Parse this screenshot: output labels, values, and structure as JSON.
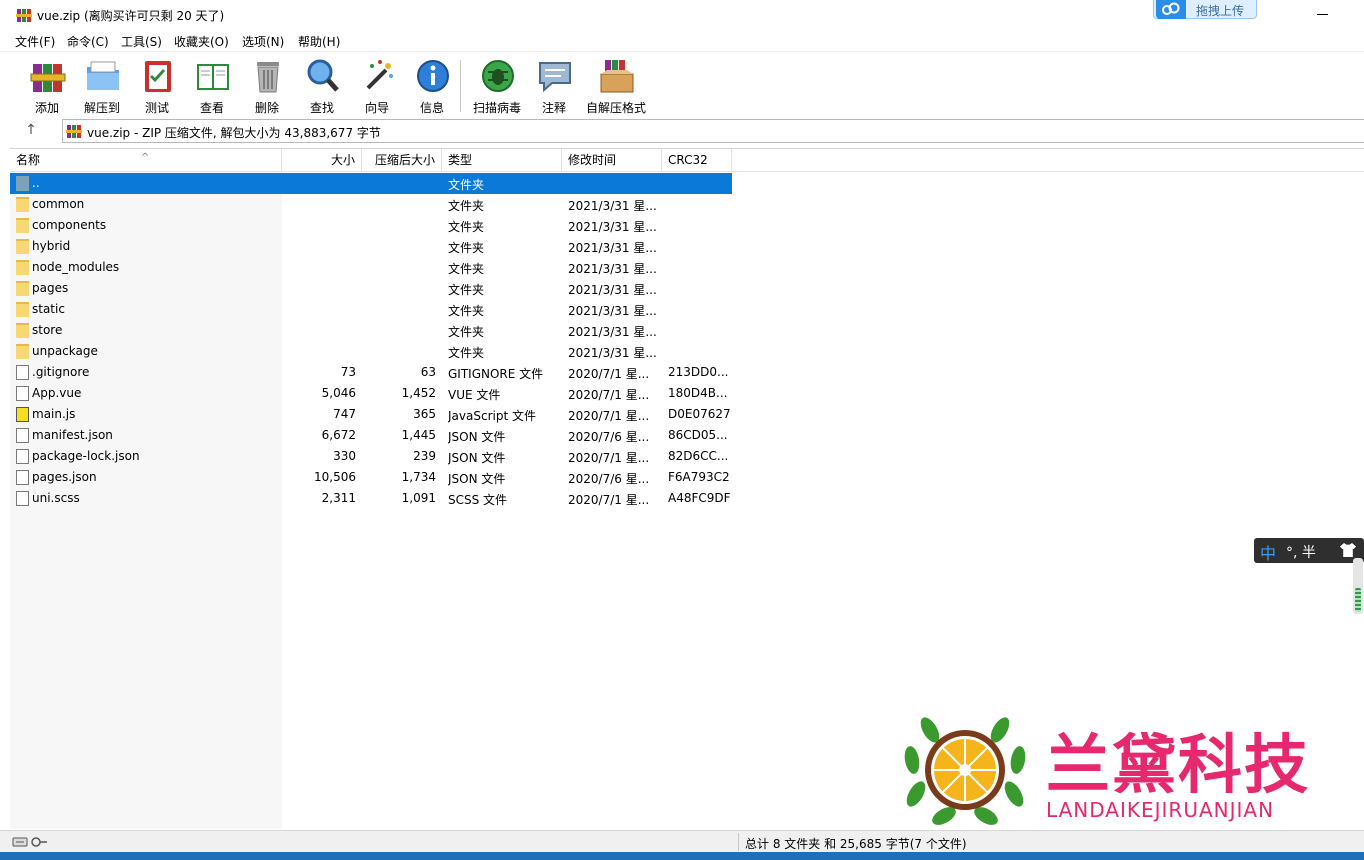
{
  "window": {
    "title": "vue.zip (离购买许可只剩 20 天了)",
    "upload_button": "拖拽上传"
  },
  "menu": [
    "文件(F)",
    "命令(C)",
    "工具(S)",
    "收藏夹(O)",
    "选项(N)",
    "帮助(H)"
  ],
  "toolbar": [
    {
      "label": "添加",
      "icon": "books-add-icon"
    },
    {
      "label": "解压到",
      "icon": "folder-extract-icon"
    },
    {
      "label": "测试",
      "icon": "clipboard-test-icon"
    },
    {
      "label": "查看",
      "icon": "book-view-icon"
    },
    {
      "label": "删除",
      "icon": "trash-icon"
    },
    {
      "label": "查找",
      "icon": "magnifier-icon"
    },
    {
      "label": "向导",
      "icon": "magic-wand-icon"
    },
    {
      "label": "信息",
      "icon": "info-icon"
    },
    {
      "label": "扫描病毒",
      "icon": "virus-scan-icon"
    },
    {
      "label": "注释",
      "icon": "comment-icon"
    },
    {
      "label": "自解压格式",
      "icon": "sfx-box-icon"
    }
  ],
  "address": {
    "path": "vue.zip - ZIP 压缩文件, 解包大小为 43,883,677 字节"
  },
  "columns": {
    "name": "名称",
    "size": "大小",
    "packed": "压缩后大小",
    "type": "类型",
    "modified": "修改时间",
    "crc": "CRC32"
  },
  "files": [
    {
      "name": "..",
      "size": "",
      "packed": "",
      "type": "文件夹",
      "modified": "",
      "crc": "",
      "kind": "parent",
      "selected": true
    },
    {
      "name": "common",
      "size": "",
      "packed": "",
      "type": "文件夹",
      "modified": "2021/3/31 星...",
      "crc": "",
      "kind": "folder"
    },
    {
      "name": "components",
      "size": "",
      "packed": "",
      "type": "文件夹",
      "modified": "2021/3/31 星...",
      "crc": "",
      "kind": "folder"
    },
    {
      "name": "hybrid",
      "size": "",
      "packed": "",
      "type": "文件夹",
      "modified": "2021/3/31 星...",
      "crc": "",
      "kind": "folder"
    },
    {
      "name": "node_modules",
      "size": "",
      "packed": "",
      "type": "文件夹",
      "modified": "2021/3/31 星...",
      "crc": "",
      "kind": "folder"
    },
    {
      "name": "pages",
      "size": "",
      "packed": "",
      "type": "文件夹",
      "modified": "2021/3/31 星...",
      "crc": "",
      "kind": "folder"
    },
    {
      "name": "static",
      "size": "",
      "packed": "",
      "type": "文件夹",
      "modified": "2021/3/31 星...",
      "crc": "",
      "kind": "folder"
    },
    {
      "name": "store",
      "size": "",
      "packed": "",
      "type": "文件夹",
      "modified": "2021/3/31 星...",
      "crc": "",
      "kind": "folder"
    },
    {
      "name": "unpackage",
      "size": "",
      "packed": "",
      "type": "文件夹",
      "modified": "2021/3/31 星...",
      "crc": "",
      "kind": "folder"
    },
    {
      "name": ".gitignore",
      "size": "73",
      "packed": "63",
      "type": "GITIGNORE 文件",
      "modified": "2020/7/1 星...",
      "crc": "213DD0...",
      "kind": "file"
    },
    {
      "name": "App.vue",
      "size": "5,046",
      "packed": "1,452",
      "type": "VUE 文件",
      "modified": "2020/7/1 星...",
      "crc": "180D4B...",
      "kind": "file"
    },
    {
      "name": "main.js",
      "size": "747",
      "packed": "365",
      "type": "JavaScript 文件",
      "modified": "2020/7/1 星...",
      "crc": "D0E07627",
      "kind": "js"
    },
    {
      "name": "manifest.json",
      "size": "6,672",
      "packed": "1,445",
      "type": "JSON 文件",
      "modified": "2020/7/6 星...",
      "crc": "86CD05...",
      "kind": "file"
    },
    {
      "name": "package-lock.json",
      "size": "330",
      "packed": "239",
      "type": "JSON 文件",
      "modified": "2020/7/1 星...",
      "crc": "82D6CC...",
      "kind": "file"
    },
    {
      "name": "pages.json",
      "size": "10,506",
      "packed": "1,734",
      "type": "JSON 文件",
      "modified": "2020/7/6 星...",
      "crc": "F6A793C2",
      "kind": "file"
    },
    {
      "name": "uni.scss",
      "size": "2,311",
      "packed": "1,091",
      "type": "SCSS 文件",
      "modified": "2020/7/1 星...",
      "crc": "A48FC9DF",
      "kind": "file"
    }
  ],
  "ime": {
    "mode": "中",
    "rest": "°, 半"
  },
  "watermark": {
    "brand": "兰黛科技",
    "sub": "LANDAIKEJIRUANJIAN"
  },
  "status": {
    "summary": "总计 8 文件夹 和 25,685 字节(7 个文件)"
  },
  "colors": {
    "selection": "#0a79d7",
    "brand": "#e6286e",
    "taskbar": "#1f6fb8"
  }
}
